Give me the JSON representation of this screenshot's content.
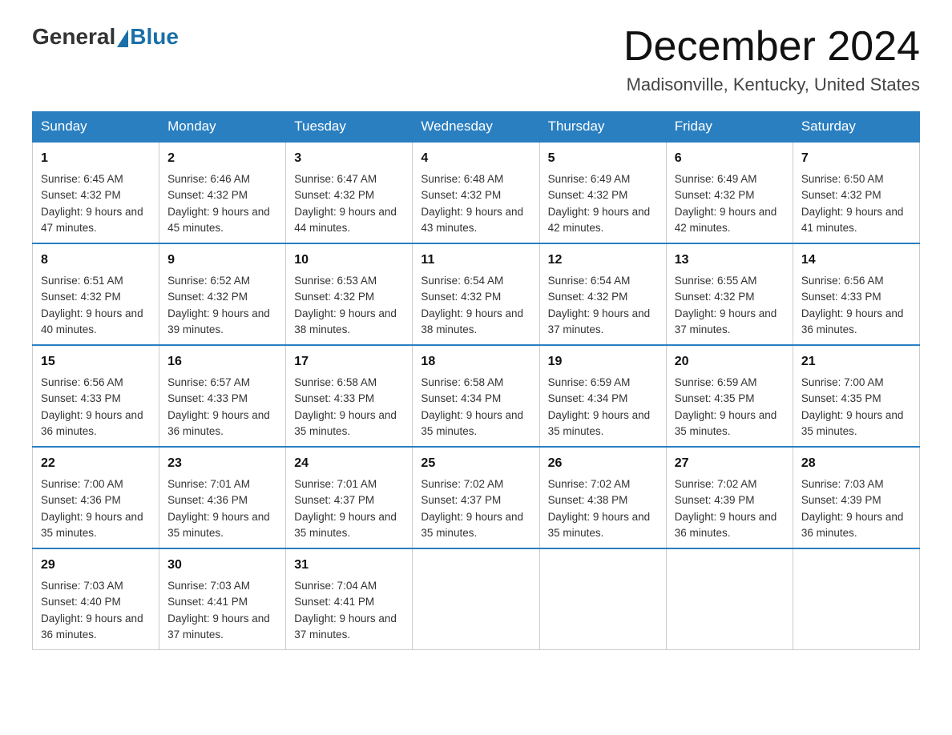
{
  "header": {
    "logo_general": "General",
    "logo_blue": "Blue",
    "month_title": "December 2024",
    "location": "Madisonville, Kentucky, United States"
  },
  "days_of_week": [
    "Sunday",
    "Monday",
    "Tuesday",
    "Wednesday",
    "Thursday",
    "Friday",
    "Saturday"
  ],
  "weeks": [
    [
      {
        "day": "1",
        "sunrise": "6:45 AM",
        "sunset": "4:32 PM",
        "daylight": "9 hours and 47 minutes."
      },
      {
        "day": "2",
        "sunrise": "6:46 AM",
        "sunset": "4:32 PM",
        "daylight": "9 hours and 45 minutes."
      },
      {
        "day": "3",
        "sunrise": "6:47 AM",
        "sunset": "4:32 PM",
        "daylight": "9 hours and 44 minutes."
      },
      {
        "day": "4",
        "sunrise": "6:48 AM",
        "sunset": "4:32 PM",
        "daylight": "9 hours and 43 minutes."
      },
      {
        "day": "5",
        "sunrise": "6:49 AM",
        "sunset": "4:32 PM",
        "daylight": "9 hours and 42 minutes."
      },
      {
        "day": "6",
        "sunrise": "6:49 AM",
        "sunset": "4:32 PM",
        "daylight": "9 hours and 42 minutes."
      },
      {
        "day": "7",
        "sunrise": "6:50 AM",
        "sunset": "4:32 PM",
        "daylight": "9 hours and 41 minutes."
      }
    ],
    [
      {
        "day": "8",
        "sunrise": "6:51 AM",
        "sunset": "4:32 PM",
        "daylight": "9 hours and 40 minutes."
      },
      {
        "day": "9",
        "sunrise": "6:52 AM",
        "sunset": "4:32 PM",
        "daylight": "9 hours and 39 minutes."
      },
      {
        "day": "10",
        "sunrise": "6:53 AM",
        "sunset": "4:32 PM",
        "daylight": "9 hours and 38 minutes."
      },
      {
        "day": "11",
        "sunrise": "6:54 AM",
        "sunset": "4:32 PM",
        "daylight": "9 hours and 38 minutes."
      },
      {
        "day": "12",
        "sunrise": "6:54 AM",
        "sunset": "4:32 PM",
        "daylight": "9 hours and 37 minutes."
      },
      {
        "day": "13",
        "sunrise": "6:55 AM",
        "sunset": "4:32 PM",
        "daylight": "9 hours and 37 minutes."
      },
      {
        "day": "14",
        "sunrise": "6:56 AM",
        "sunset": "4:33 PM",
        "daylight": "9 hours and 36 minutes."
      }
    ],
    [
      {
        "day": "15",
        "sunrise": "6:56 AM",
        "sunset": "4:33 PM",
        "daylight": "9 hours and 36 minutes."
      },
      {
        "day": "16",
        "sunrise": "6:57 AM",
        "sunset": "4:33 PM",
        "daylight": "9 hours and 36 minutes."
      },
      {
        "day": "17",
        "sunrise": "6:58 AM",
        "sunset": "4:33 PM",
        "daylight": "9 hours and 35 minutes."
      },
      {
        "day": "18",
        "sunrise": "6:58 AM",
        "sunset": "4:34 PM",
        "daylight": "9 hours and 35 minutes."
      },
      {
        "day": "19",
        "sunrise": "6:59 AM",
        "sunset": "4:34 PM",
        "daylight": "9 hours and 35 minutes."
      },
      {
        "day": "20",
        "sunrise": "6:59 AM",
        "sunset": "4:35 PM",
        "daylight": "9 hours and 35 minutes."
      },
      {
        "day": "21",
        "sunrise": "7:00 AM",
        "sunset": "4:35 PM",
        "daylight": "9 hours and 35 minutes."
      }
    ],
    [
      {
        "day": "22",
        "sunrise": "7:00 AM",
        "sunset": "4:36 PM",
        "daylight": "9 hours and 35 minutes."
      },
      {
        "day": "23",
        "sunrise": "7:01 AM",
        "sunset": "4:36 PM",
        "daylight": "9 hours and 35 minutes."
      },
      {
        "day": "24",
        "sunrise": "7:01 AM",
        "sunset": "4:37 PM",
        "daylight": "9 hours and 35 minutes."
      },
      {
        "day": "25",
        "sunrise": "7:02 AM",
        "sunset": "4:37 PM",
        "daylight": "9 hours and 35 minutes."
      },
      {
        "day": "26",
        "sunrise": "7:02 AM",
        "sunset": "4:38 PM",
        "daylight": "9 hours and 35 minutes."
      },
      {
        "day": "27",
        "sunrise": "7:02 AM",
        "sunset": "4:39 PM",
        "daylight": "9 hours and 36 minutes."
      },
      {
        "day": "28",
        "sunrise": "7:03 AM",
        "sunset": "4:39 PM",
        "daylight": "9 hours and 36 minutes."
      }
    ],
    [
      {
        "day": "29",
        "sunrise": "7:03 AM",
        "sunset": "4:40 PM",
        "daylight": "9 hours and 36 minutes."
      },
      {
        "day": "30",
        "sunrise": "7:03 AM",
        "sunset": "4:41 PM",
        "daylight": "9 hours and 37 minutes."
      },
      {
        "day": "31",
        "sunrise": "7:04 AM",
        "sunset": "4:41 PM",
        "daylight": "9 hours and 37 minutes."
      },
      null,
      null,
      null,
      null
    ]
  ],
  "labels": {
    "sunrise": "Sunrise:",
    "sunset": "Sunset:",
    "daylight": "Daylight:"
  }
}
